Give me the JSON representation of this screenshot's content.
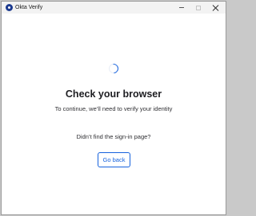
{
  "window": {
    "title": "Okta Verify",
    "app_icon": "okta-verify-logo",
    "controls": [
      "minimize",
      "maximize",
      "close"
    ]
  },
  "main": {
    "heading": "Check your browser",
    "subtext": "To continue, we’ll need to verify your identity",
    "help_text": "Didn’t find the sign-in page?",
    "go_back_label": "Go back"
  },
  "colors": {
    "accent": "#1662dd",
    "text": "#1d1d21",
    "titlebar": "#f3f3f3"
  }
}
